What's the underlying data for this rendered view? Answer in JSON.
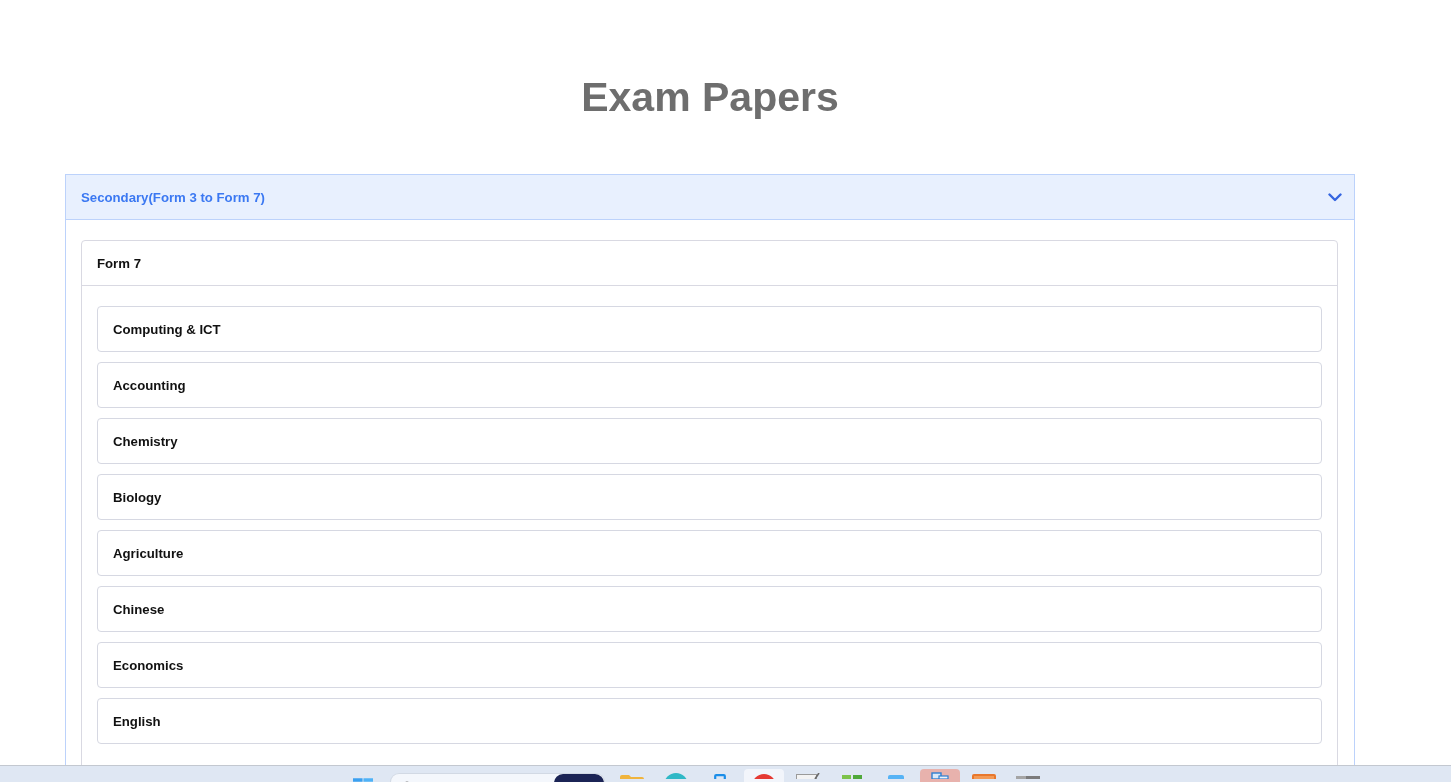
{
  "page": {
    "title": "Exam Papers"
  },
  "accordion": {
    "title": "Secondary(Form 3 to Form 7)",
    "expanded": true,
    "form": {
      "title": "Form 7",
      "subjects": [
        {
          "label": "Computing & ICT"
        },
        {
          "label": "Accounting"
        },
        {
          "label": "Chemistry"
        },
        {
          "label": "Biology"
        },
        {
          "label": "Agriculture"
        },
        {
          "label": "Chinese"
        },
        {
          "label": "Economics"
        },
        {
          "label": "English"
        }
      ]
    }
  },
  "taskbar": {
    "apps": [
      {
        "kind": "folder",
        "selected": false,
        "attention": false
      },
      {
        "kind": "sphere",
        "selected": false,
        "attention": false
      },
      {
        "kind": "phone",
        "selected": false,
        "attention": false
      },
      {
        "kind": "circle",
        "selected": true,
        "attention": false
      },
      {
        "kind": "notepad",
        "selected": false,
        "attention": false
      },
      {
        "kind": "grid",
        "selected": false,
        "attention": false
      },
      {
        "kind": "tablet",
        "selected": false,
        "attention": false
      },
      {
        "kind": "document",
        "selected": false,
        "attention": true
      },
      {
        "kind": "box",
        "selected": false,
        "attention": false
      },
      {
        "kind": "drive",
        "selected": false,
        "attention": false
      }
    ]
  }
}
